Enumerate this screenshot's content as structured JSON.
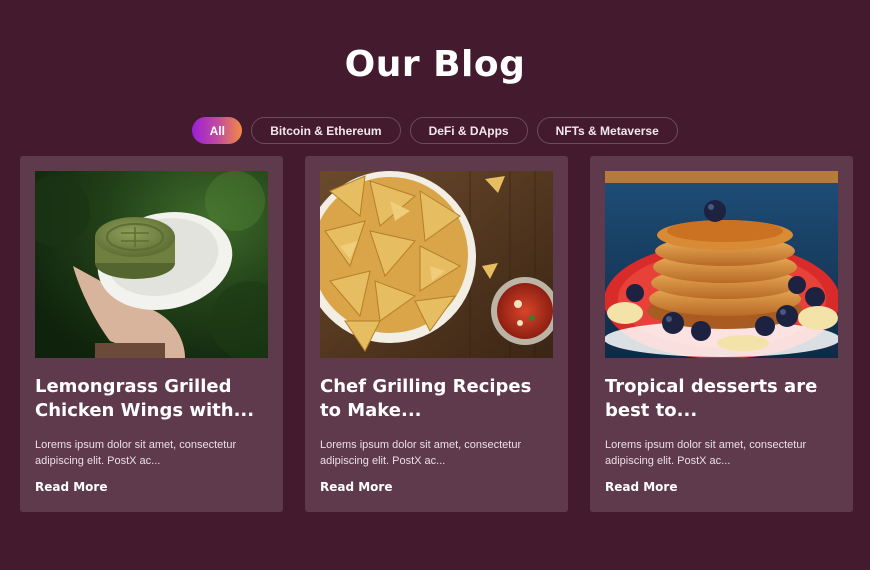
{
  "heading": "Our Blog",
  "filters": [
    {
      "label": "All",
      "active": true
    },
    {
      "label": "Bitcoin & Ethereum",
      "active": false
    },
    {
      "label": "DeFi & DApps",
      "active": false
    },
    {
      "label": "NFTs & Metaverse",
      "active": false
    }
  ],
  "posts": [
    {
      "title": "Lemongrass Grilled Chicken Wings with...",
      "excerpt": "Lorems ipsum dolor sit amet, consectetur adipiscing elit. PostX ac...",
      "read_more": "Read More",
      "image": "mooncake-on-plate"
    },
    {
      "title": "Chef Grilling Recipes to Make...",
      "excerpt": "Lorems ipsum dolor sit amet, consectetur adipiscing elit. PostX ac...",
      "read_more": "Read More",
      "image": "tortilla-chips-and-salsa"
    },
    {
      "title": "Tropical desserts are best to...",
      "excerpt": "Lorems ipsum dolor sit amet, consectetur adipiscing elit. PostX ac...",
      "read_more": "Read More",
      "image": "pancakes-with-blueberries"
    }
  ],
  "colors": {
    "background": "#441a2e",
    "card": "#5e3a4c",
    "filter_gradient_start": "#9b1fd6",
    "filter_gradient_end": "#f08a45"
  }
}
